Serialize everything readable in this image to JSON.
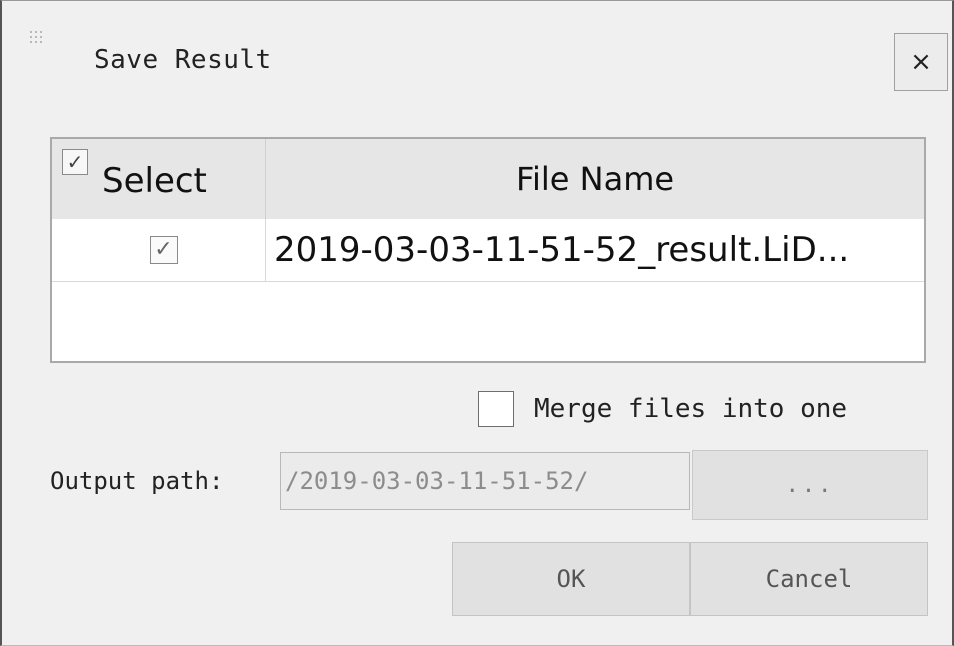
{
  "dialog": {
    "title": "Save Result",
    "close_label": "×"
  },
  "table": {
    "select_header": "Select",
    "select_all_checked": true,
    "filename_header": "File Name",
    "rows": [
      {
        "checked": true,
        "check_glyph": "✓",
        "file_name": "2019-03-03-11-51-52_result.LiD..."
      }
    ],
    "header_check_glyph": "✓"
  },
  "merge": {
    "label": "Merge files into one",
    "checked": false
  },
  "output": {
    "label": "Output path:",
    "value": "/2019-03-03-11-51-52/",
    "browse_label": "..."
  },
  "buttons": {
    "ok_label": "OK",
    "cancel_label": "Cancel"
  },
  "icons": {
    "close": "close-icon",
    "grip": "drag-grip-icon",
    "check": "checkmark-icon"
  }
}
